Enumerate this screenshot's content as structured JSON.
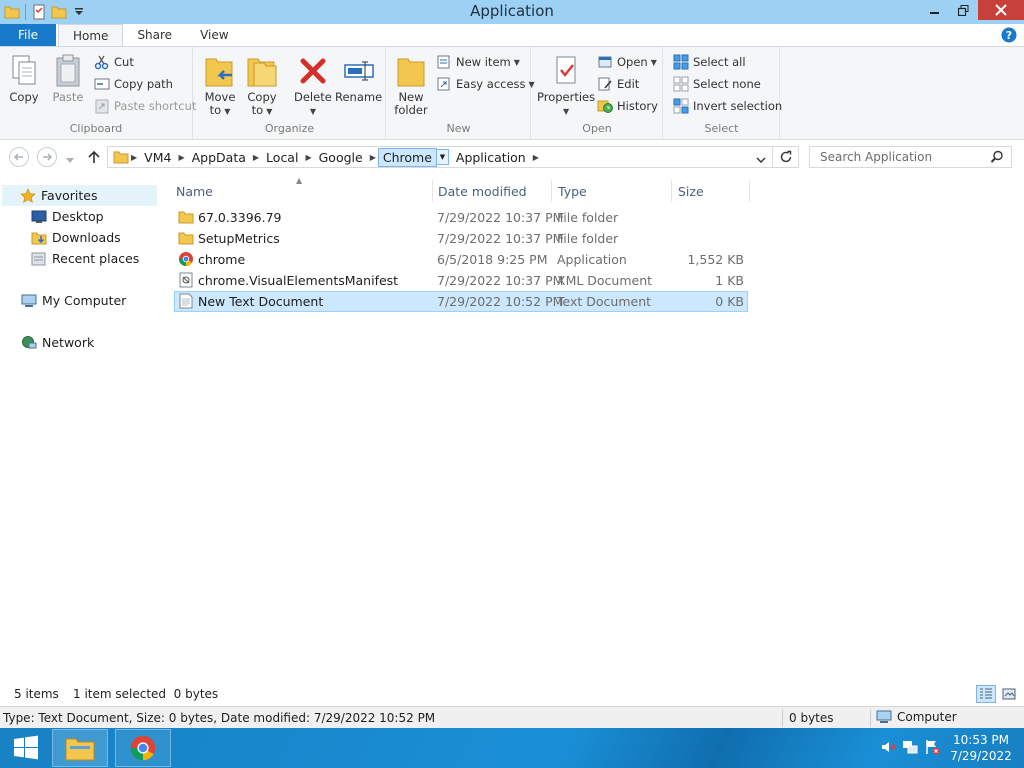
{
  "window": {
    "title": "Application"
  },
  "tabs": {
    "file": "File",
    "home": "Home",
    "share": "Share",
    "view": "View"
  },
  "ribbon": {
    "clipboard": {
      "label": "Clipboard",
      "copy": "Copy",
      "paste": "Paste",
      "cut": "Cut",
      "copy_path": "Copy path",
      "paste_shortcut": "Paste shortcut"
    },
    "organize": {
      "label": "Organize",
      "move_to": [
        "Move",
        "to"
      ],
      "copy_to": [
        "Copy",
        "to"
      ],
      "delete": "Delete",
      "rename": "Rename"
    },
    "new": {
      "label": "New",
      "new_folder": [
        "New",
        "folder"
      ],
      "new_item": "New item",
      "easy_access": "Easy access"
    },
    "open": {
      "label": "Open",
      "properties": "Properties",
      "open": "Open",
      "edit": "Edit",
      "history": "History"
    },
    "select": {
      "label": "Select",
      "select_all": "Select all",
      "select_none": "Select none",
      "invert_selection": "Invert selection"
    }
  },
  "address": {
    "crumbs": [
      "VM4",
      "AppData",
      "Local",
      "Google",
      "Chrome",
      "Application"
    ],
    "active_index": 4
  },
  "search": {
    "placeholder": "Search Application"
  },
  "navpane": {
    "favorites": "Favorites",
    "desktop": "Desktop",
    "downloads": "Downloads",
    "recent_places": "Recent places",
    "my_computer": "My Computer",
    "network": "Network"
  },
  "columns": {
    "name": "Name",
    "date_modified": "Date modified",
    "type": "Type",
    "size": "Size"
  },
  "files": [
    {
      "name": "67.0.3396.79",
      "date": "7/29/2022 10:37 PM",
      "type": "File folder",
      "size": "",
      "icon": "folder-icon"
    },
    {
      "name": "SetupMetrics",
      "date": "7/29/2022 10:37 PM",
      "type": "File folder",
      "size": "",
      "icon": "folder-icon"
    },
    {
      "name": "chrome",
      "date": "6/5/2018 9:25 PM",
      "type": "Application",
      "size": "1,552 KB",
      "icon": "chrome-icon"
    },
    {
      "name": "chrome.VisualElementsManifest",
      "date": "7/29/2022 10:37 PM",
      "type": "XML Document",
      "size": "1 KB",
      "icon": "xml-document-icon"
    },
    {
      "name": "New Text Document",
      "date": "7/29/2022 10:52 PM",
      "type": "Text Document",
      "size": "0 KB",
      "icon": "text-document-icon"
    }
  ],
  "selected_file_index": 4,
  "status": {
    "item_count": "5 items",
    "selection": "1 item selected  0 bytes",
    "details": "Type: Text Document, Size: 0 bytes, Date modified: 7/29/2022 10:52 PM",
    "size": "0 bytes",
    "location": "Computer"
  },
  "taskbar": {
    "time": "10:53 PM",
    "date": "7/29/2022"
  },
  "colors": {
    "title_bar": "#9dd1f3",
    "file_tab": "#1979ca",
    "close_button": "#c7413a",
    "selection": "#cce8ff",
    "taskbar": "#1a8fd6"
  }
}
